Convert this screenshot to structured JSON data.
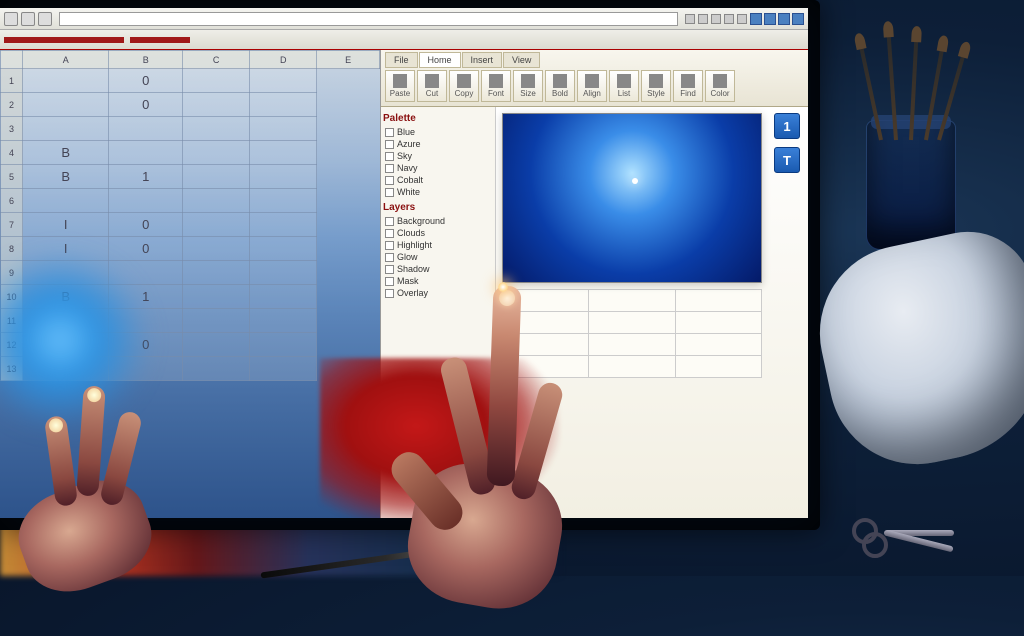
{
  "browser": {
    "tray_items": [
      "",
      "",
      "",
      ""
    ]
  },
  "toolbar": {
    "red_accent": "#a01818"
  },
  "spreadsheet": {
    "columns": [
      "",
      "A",
      "B",
      "C",
      "D",
      "E"
    ],
    "rows": [
      [
        "1",
        "",
        "0",
        "",
        ""
      ],
      [
        "2",
        "",
        "0",
        "",
        ""
      ],
      [
        "3",
        "",
        "",
        "",
        ""
      ],
      [
        "4",
        "B",
        "",
        "",
        ""
      ],
      [
        "5",
        "B",
        "1",
        "",
        ""
      ],
      [
        "6",
        "",
        "",
        "",
        ""
      ],
      [
        "7",
        "I",
        "0",
        "",
        ""
      ],
      [
        "8",
        "I",
        "0",
        "",
        ""
      ],
      [
        "9",
        "",
        "",
        "",
        ""
      ],
      [
        "10",
        "B",
        "1",
        "",
        ""
      ],
      [
        "11",
        "",
        "",
        "",
        ""
      ],
      [
        "12",
        "I",
        "0",
        "",
        ""
      ],
      [
        "13",
        "",
        "",
        "",
        ""
      ]
    ]
  },
  "office": {
    "ribbon_tabs": [
      "File",
      "Home",
      "Insert",
      "View"
    ],
    "ribbon_buttons": [
      "Paste",
      "Cut",
      "Copy",
      "Font",
      "Size",
      "Bold",
      "Align",
      "List",
      "Style",
      "Find",
      "Color"
    ],
    "list_groups": [
      {
        "label": "Palette",
        "items": [
          "Blue",
          "Azure",
          "Sky",
          "Navy",
          "Cobalt",
          "White"
        ]
      },
      {
        "label": "Layers",
        "items": [
          "Background",
          "Clouds",
          "Highlight",
          "Glow",
          "Shadow",
          "Mask",
          "Overlay"
        ]
      }
    ],
    "side_buttons": [
      "1",
      "T"
    ],
    "lower_rows": [
      [
        "",
        "",
        ""
      ],
      [
        "",
        "",
        ""
      ],
      [
        "",
        "",
        ""
      ],
      [
        "",
        "",
        ""
      ]
    ]
  },
  "colors": {
    "preview_blue": "#0a3da8",
    "splash_red": "#c41818",
    "accent_blue": "#2a6ad0"
  }
}
